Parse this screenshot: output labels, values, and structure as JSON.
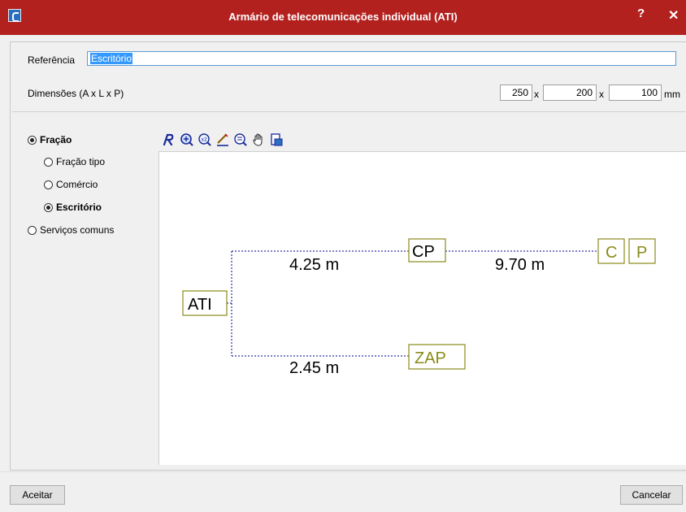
{
  "window": {
    "title": "Armário de telecomunicações individual (ATI)",
    "help": "?",
    "close": "✕"
  },
  "form": {
    "referencia_label": "Referência",
    "referencia_value": "Escritório",
    "dimensoes_label": "Dimensões (A x L x P)",
    "a": "250",
    "l": "200",
    "p": "100",
    "x1": "x",
    "x2": "x",
    "unit": "mm"
  },
  "options": {
    "fracao": "Fração",
    "fracao_tipo": "Fração tipo",
    "comercio": "Comércio",
    "escritorio": "Escritório",
    "servicos_comuns": "Serviços comuns",
    "selected_group": "Fração",
    "selected_sub": "Escritório"
  },
  "toolbar": {
    "icons": [
      "redraw-icon",
      "zoom-window-icon",
      "zoom-all-icon",
      "measure-icon",
      "zoom-previous-icon",
      "pan-hand-icon",
      "print-icon"
    ]
  },
  "diagram": {
    "nodes": {
      "ati": "ATI",
      "cp": "CP",
      "zap": "ZAP",
      "c": "C",
      "p": "P"
    },
    "distances": {
      "ati_cp": "4.25 m",
      "cp_cp2": "9.70 m",
      "ati_zap": "2.45 m"
    },
    "colors": {
      "box": "#8a8a1a",
      "line": "#00008b"
    }
  },
  "buttons": {
    "aceitar": "Aceitar",
    "cancelar": "Cancelar"
  }
}
